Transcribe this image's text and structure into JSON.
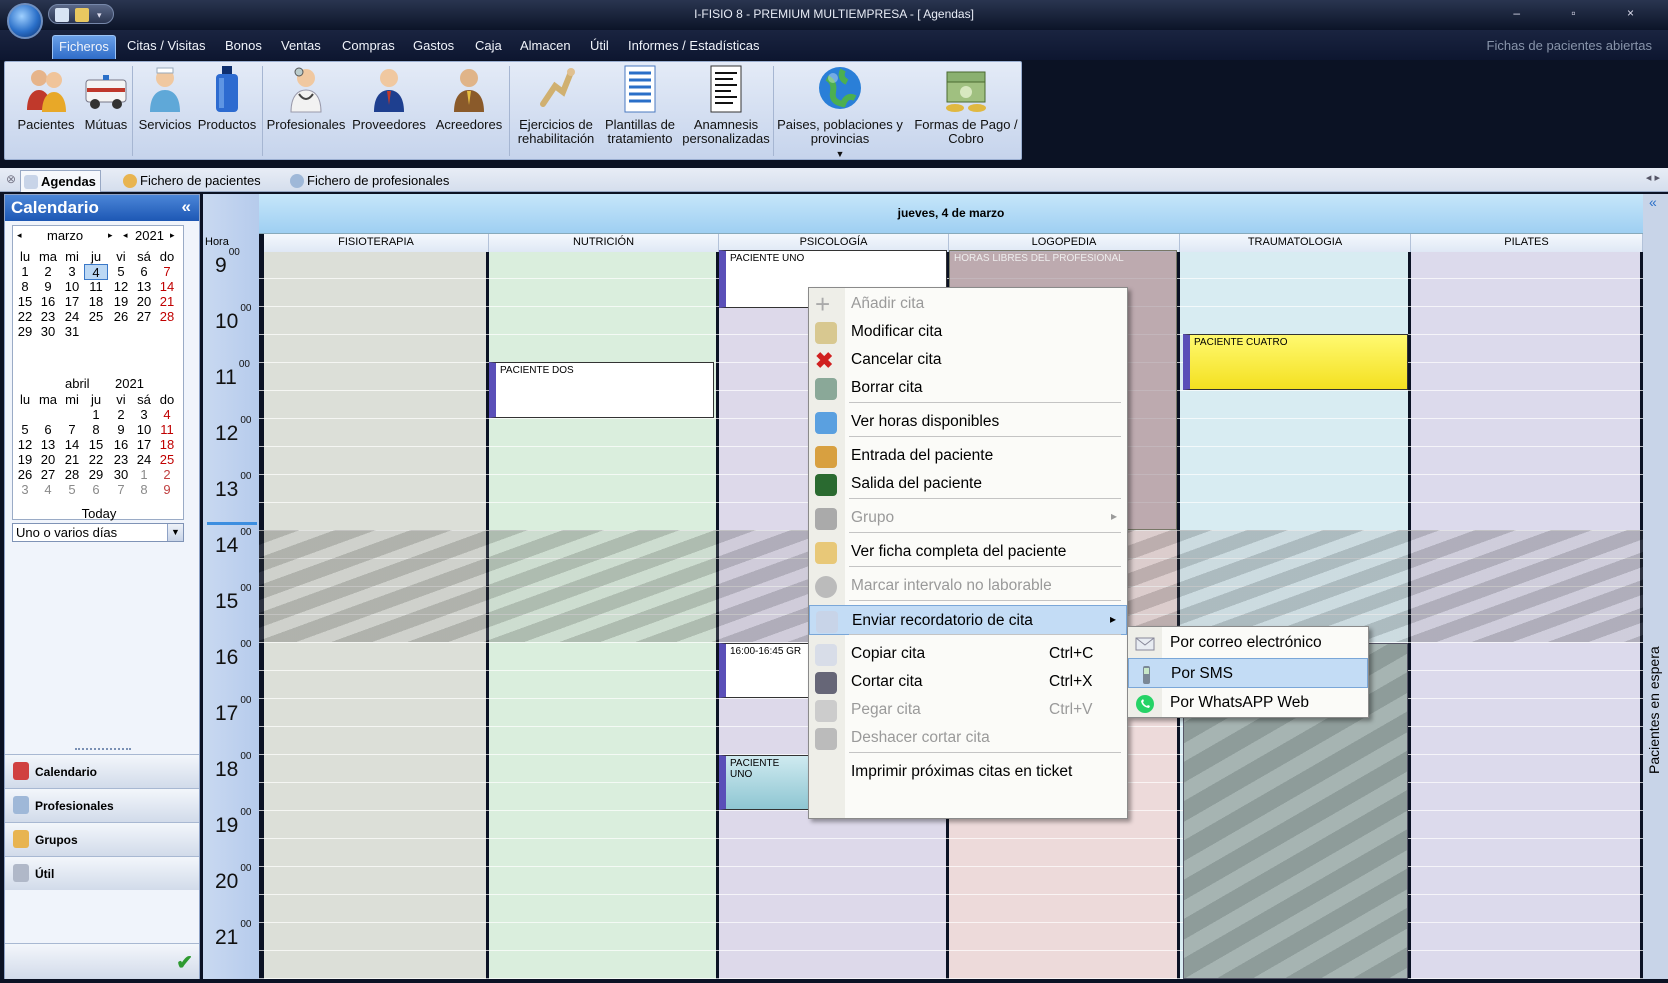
{
  "window": {
    "title": "I-FISIO 8 - PREMIUM MULTIEMPRESA - [ Agendas]",
    "controls": "– ▫ ×"
  },
  "menu": {
    "items": [
      "Ficheros",
      "Citas / Visitas",
      "Bonos",
      "Ventas",
      "Compras",
      "Gastos",
      "Caja",
      "Almacen",
      "Útil",
      "Informes / Estadísticas"
    ],
    "right_text": "Fichas de pacientes abiertas"
  },
  "ribbon": {
    "buttons": [
      {
        "label": "Pacientes",
        "icon": "patients-icon"
      },
      {
        "label": "Mútuas",
        "icon": "ambulance-icon"
      },
      {
        "label": "Servicios",
        "icon": "nurse-icon"
      },
      {
        "label": "Productos",
        "icon": "bottle-icon"
      },
      {
        "label": "Profesionales",
        "icon": "doctor-icon"
      },
      {
        "label": "Proveedores",
        "icon": "businessman-icon"
      },
      {
        "label": "Acreedores",
        "icon": "creditor-icon"
      },
      {
        "label": "Ejercicios de rehabilitación",
        "icon": "exercise-icon"
      },
      {
        "label": "Plantillas de tratamiento",
        "icon": "template-icon"
      },
      {
        "label": "Anamnesis personalizadas",
        "icon": "document-icon"
      },
      {
        "label": "Paises, poblaciones y provincias",
        "icon": "globe-icon"
      },
      {
        "label": "Formas de Pago / Cobro",
        "icon": "money-icon"
      }
    ]
  },
  "tabs": [
    "Agendas",
    "Fichero de pacientes",
    "Fichero de profesionales"
  ],
  "calendar": {
    "title": "Calendario",
    "collapse": "«",
    "march": {
      "month": "marzo",
      "year": "2021",
      "days_header": [
        "lu",
        "ma",
        "mi",
        "ju",
        "vi",
        "sá",
        "do"
      ],
      "weeks": [
        [
          "1",
          "2",
          "3",
          "4",
          "5",
          "6",
          "7"
        ],
        [
          "8",
          "9",
          "10",
          "11",
          "12",
          "13",
          "14"
        ],
        [
          "15",
          "16",
          "17",
          "18",
          "19",
          "20",
          "21"
        ],
        [
          "22",
          "23",
          "24",
          "25",
          "26",
          "27",
          "28"
        ],
        [
          "29",
          "30",
          "31",
          "",
          "",
          "",
          ""
        ]
      ]
    },
    "april": {
      "month": "abril",
      "year": "2021",
      "weeks": [
        [
          "",
          "",
          "",
          "1",
          "2",
          "3",
          "4"
        ],
        [
          "5",
          "6",
          "7",
          "8",
          "9",
          "10",
          "11"
        ],
        [
          "12",
          "13",
          "14",
          "15",
          "16",
          "17",
          "18"
        ],
        [
          "19",
          "20",
          "21",
          "22",
          "23",
          "24",
          "25"
        ],
        [
          "26",
          "27",
          "28",
          "29",
          "30",
          "1",
          "2"
        ],
        [
          "3",
          "4",
          "5",
          "6",
          "7",
          "8",
          "9"
        ]
      ]
    },
    "today_label": "Today",
    "mode": "Uno o varios días"
  },
  "nav": [
    "Calendario",
    "Profesionales",
    "Grupos",
    "Útil"
  ],
  "schedule": {
    "date": "jueves, 4 de marzo",
    "hour_label": "Hora",
    "hours": [
      "9",
      "10",
      "11",
      "12",
      "13",
      "14",
      "15",
      "16",
      "17",
      "18",
      "19",
      "20",
      "21"
    ],
    "minutes": "00",
    "columns": [
      "FISIOTERAPIA",
      "NUTRICIÓN",
      "PSICOLOGÍA",
      "LOGOPEDIA",
      "TRAUMATOLOGIA",
      "PILATES"
    ],
    "column_colors": [
      "#dcdfd8",
      "#daeedd",
      "#ddd9ea",
      "#eddada",
      "#d8ecf2",
      "#dcdaec"
    ],
    "appointments": {
      "uno_am": "PACIENTE UNO",
      "dos": "PACIENTE DOS",
      "libres": "HORAS LIBRES DEL PROFESIONAL",
      "cuatro": "PACIENTE CUATRO",
      "grupo": "16:00-16:45 GR",
      "uno_pm": "PACIENTE UNO"
    }
  },
  "waiting_panel": "Pacientes en espera",
  "context_menu": {
    "items": [
      {
        "label": "Añadir cita",
        "disabled": true,
        "icon": "plus-icon"
      },
      {
        "label": "Modificar cita",
        "icon": "edit-icon"
      },
      {
        "label": "Cancelar cita",
        "icon": "red-x-icon"
      },
      {
        "label": "Borrar cita",
        "icon": "trash-icon"
      },
      {
        "label": "Ver horas disponibles",
        "icon": "calendar-grid-icon"
      },
      {
        "label": "Entrada del paciente",
        "icon": "patient-in-icon"
      },
      {
        "label": "Salida del paciente",
        "icon": "patient-out-icon"
      },
      {
        "label": "Grupo",
        "disabled": true,
        "icon": "group-icon"
      },
      {
        "label": "Ver ficha completa del paciente",
        "icon": "folder-icon"
      },
      {
        "label": "Marcar intervalo no laborable",
        "disabled": true,
        "icon": "circle-icon"
      },
      {
        "label": "Enviar recordatorio de cita",
        "icon": "send-icon"
      },
      {
        "label": "Copiar cita",
        "shortcut": "Ctrl+C",
        "icon": "copy-icon"
      },
      {
        "label": "Cortar cita",
        "shortcut": "Ctrl+X",
        "icon": "scissors-icon"
      },
      {
        "label": "Pegar cita",
        "shortcut": "Ctrl+V",
        "disabled": true,
        "icon": "paste-icon"
      },
      {
        "label": "Deshacer cortar cita",
        "disabled": true,
        "icon": "undo-icon"
      },
      {
        "label": "Imprimir próximas citas en ticket",
        "icon": "printer-icon"
      }
    ]
  },
  "submenu": {
    "items": [
      {
        "label": "Por correo electrónico",
        "icon": "envelope-icon"
      },
      {
        "label": "Por SMS",
        "icon": "mobile-phone-icon"
      },
      {
        "label": "Por WhatsAPP Web",
        "icon": "whatsapp-icon"
      }
    ]
  },
  "colors": {
    "accent": "#2f6cc8",
    "highlight": "#c3dcf5",
    "whatsapp": "#25d366"
  }
}
